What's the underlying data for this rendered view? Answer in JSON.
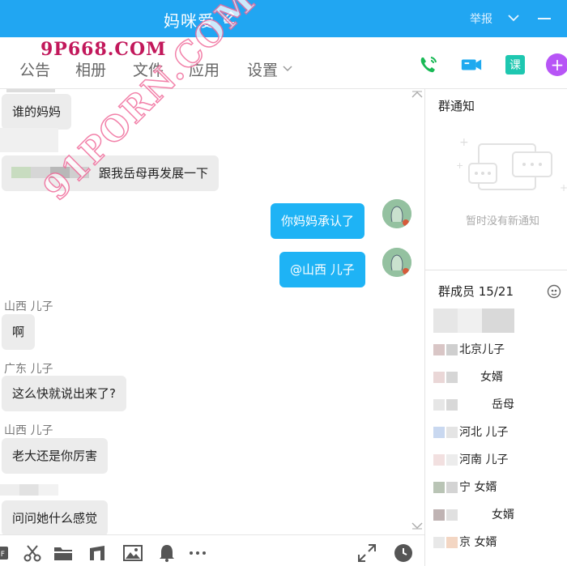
{
  "titlebar": {
    "title": "妈咪爱",
    "report_label": "举报"
  },
  "nav": {
    "tabs": [
      "公告",
      "相册",
      "文件",
      "应用",
      "设置"
    ],
    "course_label": "课"
  },
  "watermarks": {
    "top": "9P668.COM",
    "diagonal": "91PORN.COM"
  },
  "messages": [
    {
      "text": "谁的妈妈"
    },
    {
      "text": "跟我岳母再发展一下"
    },
    {
      "text": "你妈妈承认了"
    },
    {
      "text": "@山西 儿子"
    },
    {
      "sender": "山西 儿子",
      "text": "啊"
    },
    {
      "sender": "广东 儿子",
      "text": "这么快就说出来了?"
    },
    {
      "sender": "山西 儿子",
      "text": "老大还是你厉害"
    },
    {
      "text": "问问她什么感觉"
    }
  ],
  "notice": {
    "title": "群通知",
    "empty_text": "暂时没有新通知"
  },
  "members": {
    "title": "群成员 15/21",
    "items": [
      "北京儿子",
      "女婿",
      "岳母",
      "河北  儿子",
      "河南 儿子",
      "宁  女婿",
      "女婿",
      "京 女婿"
    ]
  },
  "colors": {
    "titlebar": "#21a6f2",
    "my_bubble": "#1eb3f5",
    "other_bubble": "#ececec",
    "accent_purple": "#b755f6",
    "accent_teal": "#1ec7b0"
  }
}
